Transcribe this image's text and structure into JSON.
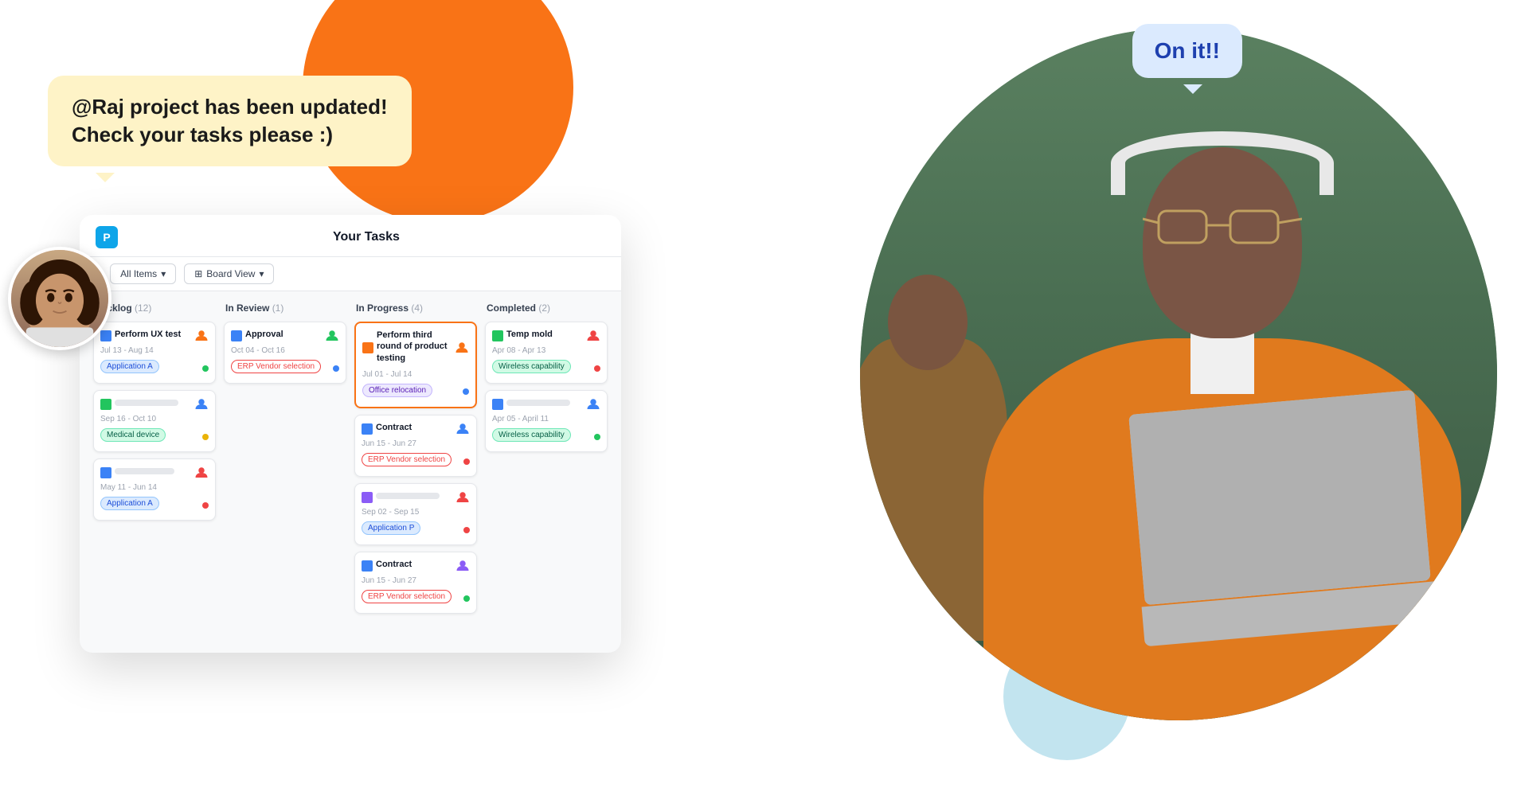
{
  "page": {
    "background": "#ffffff"
  },
  "speech_bubble_left": {
    "text": "@Raj project has been updated!\nCheck your tasks please :)"
  },
  "speech_bubble_right": {
    "text": "On it!!"
  },
  "board": {
    "title": "Your Tasks",
    "logo_letter": "P",
    "toolbar": {
      "filter_label": "All Items",
      "view_label": "Board View"
    },
    "columns": [
      {
        "name": "Backlog",
        "count": 12,
        "tasks": [
          {
            "title": "Perform UX test",
            "date": "Jul 13 - Aug 14",
            "tag": "Application A",
            "tag_type": "app-a",
            "avatar_color": "#f97316",
            "status_dot": "green",
            "icon_type": "blue"
          },
          {
            "title": "",
            "blurred": true,
            "date": "Sep 16 - Oct 10",
            "tag": "Medical device",
            "tag_type": "medical",
            "avatar_color": "#3b82f6",
            "status_dot": "yellow",
            "icon_type": "green"
          },
          {
            "title": "",
            "blurred": true,
            "date": "May 11 - Jun 14",
            "tag": "Application A",
            "tag_type": "app-a",
            "avatar_color": "#ef4444",
            "status_dot": "red",
            "icon_type": "blue"
          }
        ]
      },
      {
        "name": "In Review",
        "count": 1,
        "tasks": [
          {
            "title": "Approval",
            "date": "Oct 04 - Oct 16",
            "tag": "ERP Vendor selection",
            "tag_type": "erp",
            "avatar_color": "#22c55e",
            "status_dot": "blue",
            "icon_type": "blue"
          }
        ]
      },
      {
        "name": "In Progress",
        "count": 4,
        "tasks": [
          {
            "title": "Perform third round of product testing",
            "date": "Jul 01 - Jul 14",
            "tag": "Office relocation",
            "tag_type": "office",
            "avatar_color": "#f97316",
            "status_dot": "blue",
            "icon_type": "orange",
            "highlighted": true
          },
          {
            "title": "Contract",
            "date": "Jun 15 - Jun 27",
            "tag": "ERP Vendor selection",
            "tag_type": "erp",
            "avatar_color": "#3b82f6",
            "status_dot": "red",
            "icon_type": "blue"
          },
          {
            "title": "",
            "blurred": true,
            "date": "Sep 02 - Sep 15",
            "tag": "Application P",
            "tag_type": "app-p",
            "avatar_color": "#ef4444",
            "status_dot": "red",
            "icon_type": "purple"
          },
          {
            "title": "Contract",
            "date": "Jun 15 - Jun 27",
            "tag": "ERP Vendor selection",
            "tag_type": "erp",
            "avatar_color": "#8b5cf6",
            "status_dot": "green",
            "icon_type": "blue"
          }
        ]
      },
      {
        "name": "Completed",
        "count": 2,
        "tasks": [
          {
            "title": "Temp mold",
            "date": "Apr 08 - Apr 13",
            "tag": "Wireless capability",
            "tag_type": "wireless",
            "avatar_color": "#ef4444",
            "status_dot": "red",
            "icon_type": "green"
          },
          {
            "title": "",
            "blurred": true,
            "date": "Apr 05 - April 11",
            "tag": "Wireless capability",
            "tag_type": "wireless",
            "avatar_color": "#3b82f6",
            "status_dot": "green",
            "icon_type": "blue"
          }
        ]
      }
    ]
  }
}
